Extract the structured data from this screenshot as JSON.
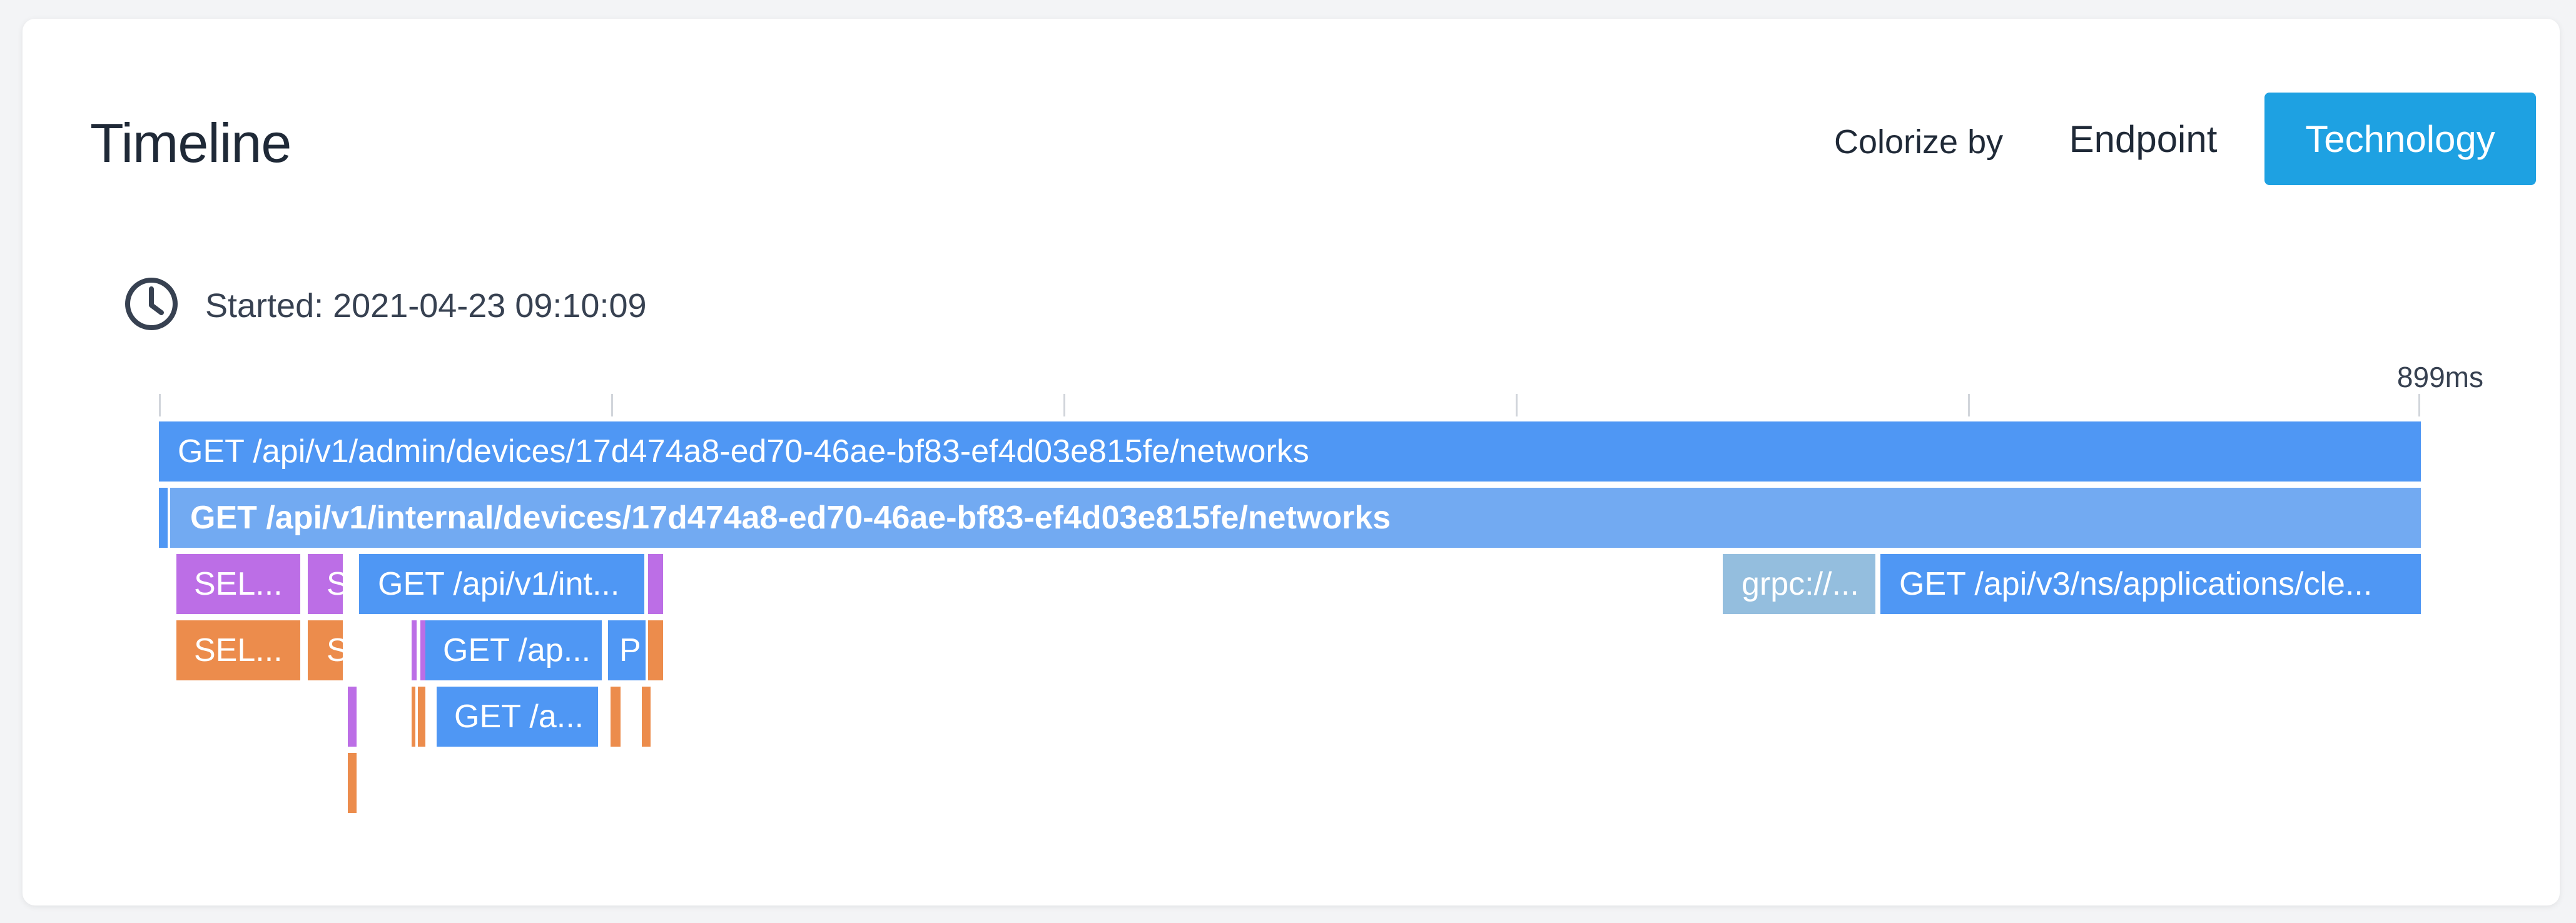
{
  "header": {
    "title": "Timeline",
    "colorize_label": "Colorize by",
    "options": [
      "Endpoint",
      "Technology"
    ],
    "selected": "Technology"
  },
  "timeline": {
    "started": "Started: 2021-04-23 09:10:09",
    "duration_label": "899ms",
    "spans": {
      "root": "GET /api/v1/admin/devices/17d474a8-ed70-46ae-bf83-ef4d03e815fe/networks",
      "internal": "GET /api/v1/internal/devices/17d474a8-ed70-46ae-bf83-ef4d03e815fe/networks",
      "sel1": "SEL...",
      "s1": "S",
      "get_int": "GET /api/v1/int...",
      "grpc": "grpc://...",
      "get_v3": "GET /api/v3/ns/applications/cle...",
      "sel2": "SEL...",
      "s2": "S",
      "get_ap": "GET /ap...",
      "p": "P",
      "get_a": "GET /a..."
    }
  },
  "colors": {
    "http": "#4f97f4",
    "http_internal": "#72aaf2",
    "db_purple": "#bc6ee6",
    "db_orange": "#ec8c4c",
    "grpc": "#94bede",
    "accent": "#1ea1e2"
  }
}
